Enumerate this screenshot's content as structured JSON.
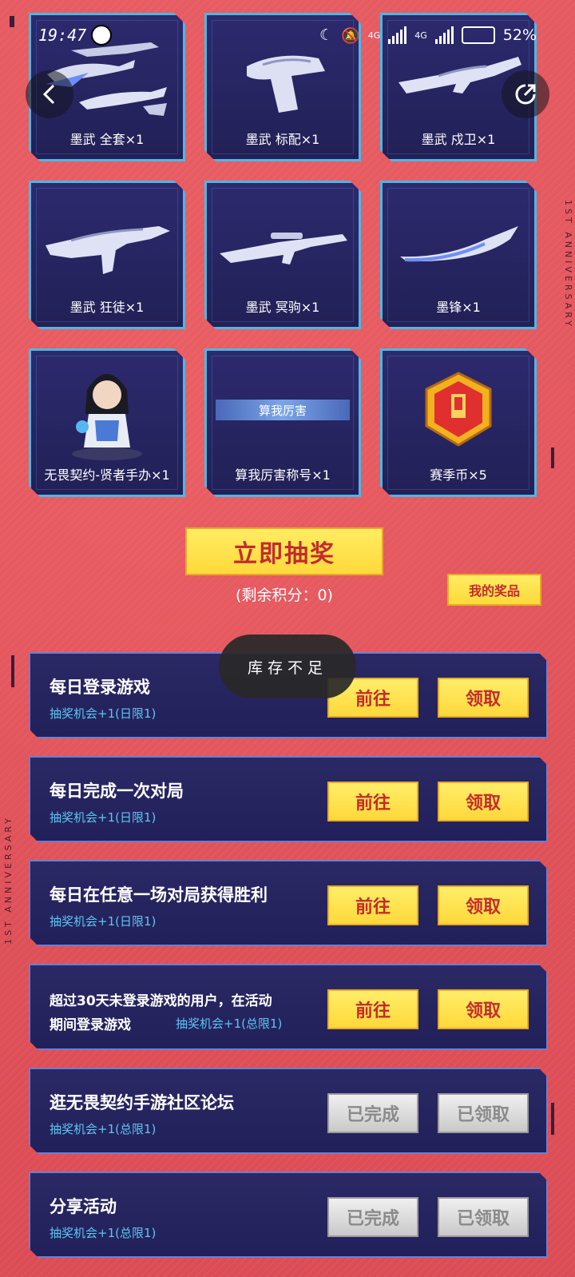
{
  "status_bar": {
    "time": "19:47",
    "network1": "4G",
    "network2": "4G",
    "battery": "52%"
  },
  "side_text": {
    "right": "1ST ANNIVERSARY",
    "left": "1ST ANNIVERSARY"
  },
  "prizes": [
    {
      "label": "墨武 全套×1",
      "icon": "weapon-set-icon"
    },
    {
      "label": "墨武 标配×1",
      "icon": "pistol-icon"
    },
    {
      "label": "墨武 戍卫×1",
      "icon": "rifle-icon"
    },
    {
      "label": "墨武 狂徒×1",
      "icon": "rifle-icon"
    },
    {
      "label": "墨武 冥驹×1",
      "icon": "sniper-icon"
    },
    {
      "label": "墨锋×1",
      "icon": "blade-icon"
    },
    {
      "label": "无畏契约-贤者手办×1",
      "icon": "figure-icon"
    },
    {
      "label": "算我厉害称号×1",
      "icon": "title-banner-icon",
      "banner": "算我厉害"
    },
    {
      "label": "赛季币×5",
      "icon": "coin-icon"
    }
  ],
  "draw": {
    "button": "立即抽奖",
    "remaining": "(剩余积分：0)",
    "my_prizes": "我的奖品"
  },
  "toast": "库存不足",
  "tasks": [
    {
      "title": "每日登录游戏",
      "sub": "抽奖机会+1(日限1)",
      "btn1": "前往",
      "btn2": "领取",
      "state": "active"
    },
    {
      "title": "每日完成一次对局",
      "sub": "抽奖机会+1(日限1)",
      "btn1": "前往",
      "btn2": "领取",
      "state": "active"
    },
    {
      "title": "每日在任意一场对局获得胜利",
      "sub": "抽奖机会+1(日限1)",
      "btn1": "前往",
      "btn2": "领取",
      "state": "active"
    },
    {
      "title": "超过30天未登录游戏的用户，在活动",
      "title_line2": "期间登录游戏",
      "sub": "抽奖机会+1(总限1)",
      "btn1": "前往",
      "btn2": "领取",
      "state": "active"
    },
    {
      "title": "逛无畏契约手游社区论坛",
      "sub": "抽奖机会+1(总限1)",
      "btn1": "已完成",
      "btn2": "已领取",
      "state": "done"
    },
    {
      "title": "分享活动",
      "sub": "抽奖机会+1(总限1)",
      "btn1": "已完成",
      "btn2": "已领取",
      "state": "done"
    }
  ],
  "colors": {
    "background": "#e0525a",
    "card": "#2a2965",
    "card_border": "#4fb6e3",
    "button_yellow": "#ffd93a",
    "button_text": "#c42b2b",
    "sub_text": "#5cc6f0"
  }
}
